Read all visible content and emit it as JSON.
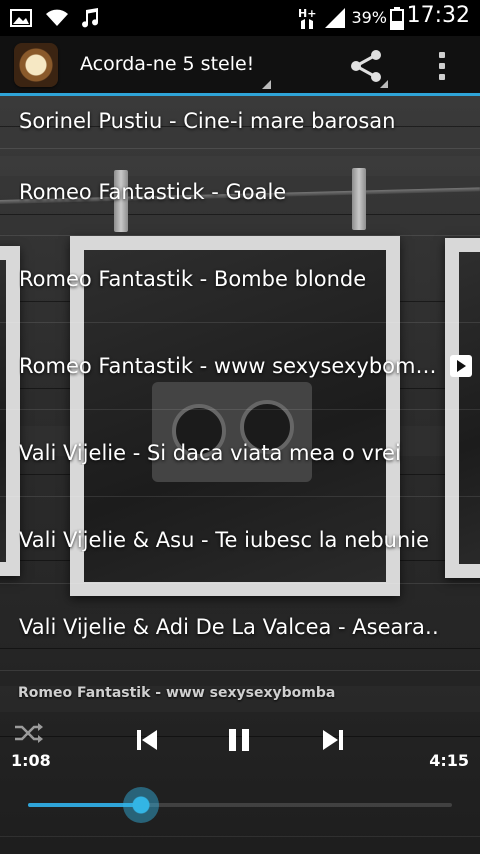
{
  "status_bar": {
    "icons": [
      "gallery-icon",
      "wifi-icon",
      "music-note-icon",
      "h-plus-network-icon",
      "signal-icon",
      "battery-icon"
    ],
    "battery_percent": "39%",
    "time": "17:32"
  },
  "action_bar": {
    "title": "Acorda-ne 5 stele!",
    "share_icon": "share-icon",
    "menu_icon": "overflow-menu-icon",
    "accent_color": "#2fa4d8"
  },
  "songs": [
    {
      "title": "Sorinel Pustiu - Cine-i mare barosan"
    },
    {
      "title": "Romeo Fantastick - Goale"
    },
    {
      "title": "Romeo Fantastik - Bombe blonde"
    },
    {
      "title": "Romeo Fantastik - www sexysexybom…",
      "playing": true
    },
    {
      "title": "Vali Vijelie - Si daca viata mea o vrei"
    },
    {
      "title": "Vali Vijelie & Asu - Te iubesc la nebunie"
    },
    {
      "title": "Vali Vijelie & Adi De La Valcea - Aseara…"
    }
  ],
  "player": {
    "now_playing": "Romeo Fantastik - www sexysexybomba",
    "elapsed": "1:08",
    "total": "4:15",
    "progress_fraction": 0.267,
    "controls": [
      "shuffle-icon",
      "previous-icon",
      "pause-icon",
      "next-icon"
    ]
  }
}
